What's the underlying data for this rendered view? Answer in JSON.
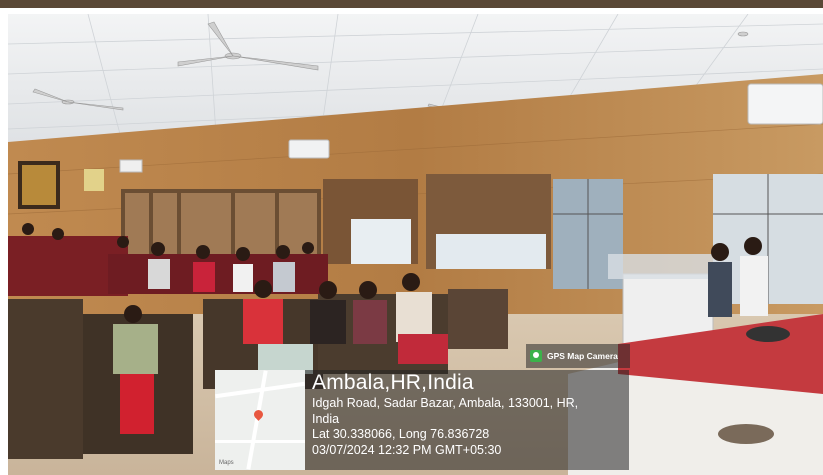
{
  "overlay": {
    "app_name": "GPS Map Camera",
    "location_title": "Ambala,HR,India",
    "address_line1": "Idgah Road, Sadar Bazar, Ambala, 133001, HR,",
    "address_line2": "India",
    "coordinates": "Lat 30.338066, Long 76.836728",
    "datetime": "03/07/2024 12:32 PM GMT+05:30",
    "map_attribution": "Maps"
  },
  "colors": {
    "wall_wood": "#b8824a",
    "ceiling": "#e9ecef",
    "chairs_maroon": "#7a1f24",
    "overlay_bg": "rgba(35,35,35,0.55)"
  },
  "icons": [
    "gps-map-camera-icon",
    "map-pin-icon"
  ]
}
